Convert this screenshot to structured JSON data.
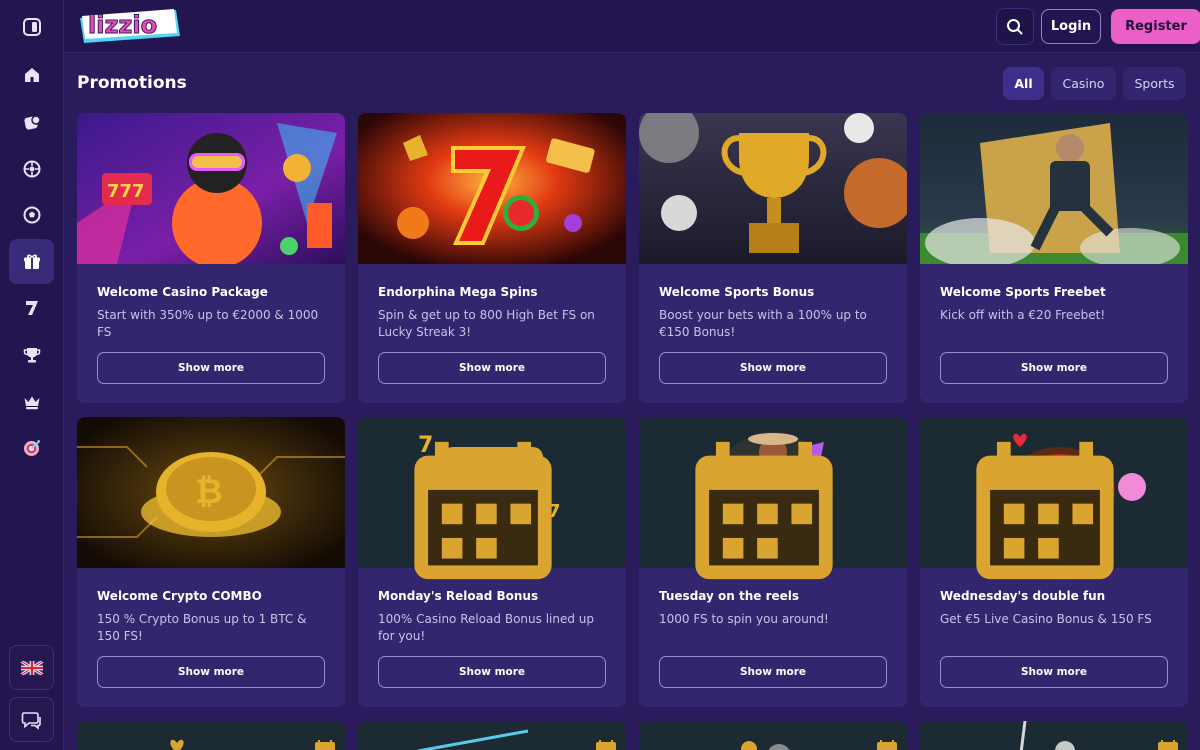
{
  "header": {
    "logo_text": "lizzio",
    "login_label": "Login",
    "register_label": "Register"
  },
  "sidebar": {
    "items": [
      {
        "icon": "toggle-sidebar-icon"
      },
      {
        "icon": "home-icon"
      },
      {
        "icon": "casino-chip-icon"
      },
      {
        "icon": "roulette-icon"
      },
      {
        "icon": "football-icon"
      },
      {
        "icon": "gift-icon",
        "active": true
      },
      {
        "icon": "seven-icon"
      },
      {
        "icon": "trophy-icon"
      },
      {
        "icon": "crown-icon"
      },
      {
        "icon": "target-icon"
      }
    ],
    "language_icon": "uk-flag-icon",
    "chat_icon": "chat-icon"
  },
  "page": {
    "title": "Promotions",
    "filters": [
      "All",
      "Casino",
      "Sports"
    ],
    "active_filter": "All"
  },
  "promotions": [
    {
      "title": "Welcome Casino Package",
      "description": "Start with 350% up to €2000 & 1000 FS",
      "button": "Show more"
    },
    {
      "title": "Endorphina Mega Spins",
      "description": "Spin & get up to 800 High Bet FS on Lucky Streak 3!",
      "button": "Show more"
    },
    {
      "title": "Welcome Sports Bonus",
      "description": "Boost your bets with a 100% up to €150 Bonus!",
      "button": "Show more"
    },
    {
      "title": "Welcome Sports Freebet",
      "description": "Kick off with a €20 Freebet!",
      "button": "Show more"
    },
    {
      "title": "Welcome Crypto COMBO",
      "description": "150 % Crypto Bonus up to 1 BTC & 150 FS!",
      "button": "Show more"
    },
    {
      "title": "Monday's Reload Bonus",
      "description": "100% Casino Reload Bonus lined up for you!",
      "button": "Show more"
    },
    {
      "title": "Tuesday on the reels",
      "description": "1000 FS to spin you around!",
      "button": "Show more"
    },
    {
      "title": "Wednesday's double fun",
      "description": "Get €5 Live Casino Bonus & 150 FS",
      "button": "Show more"
    }
  ],
  "colors": {
    "background": "#2a1c5c",
    "card": "#33256e",
    "accent_pink": "#ec5fc9",
    "sidebar": "#231650"
  }
}
